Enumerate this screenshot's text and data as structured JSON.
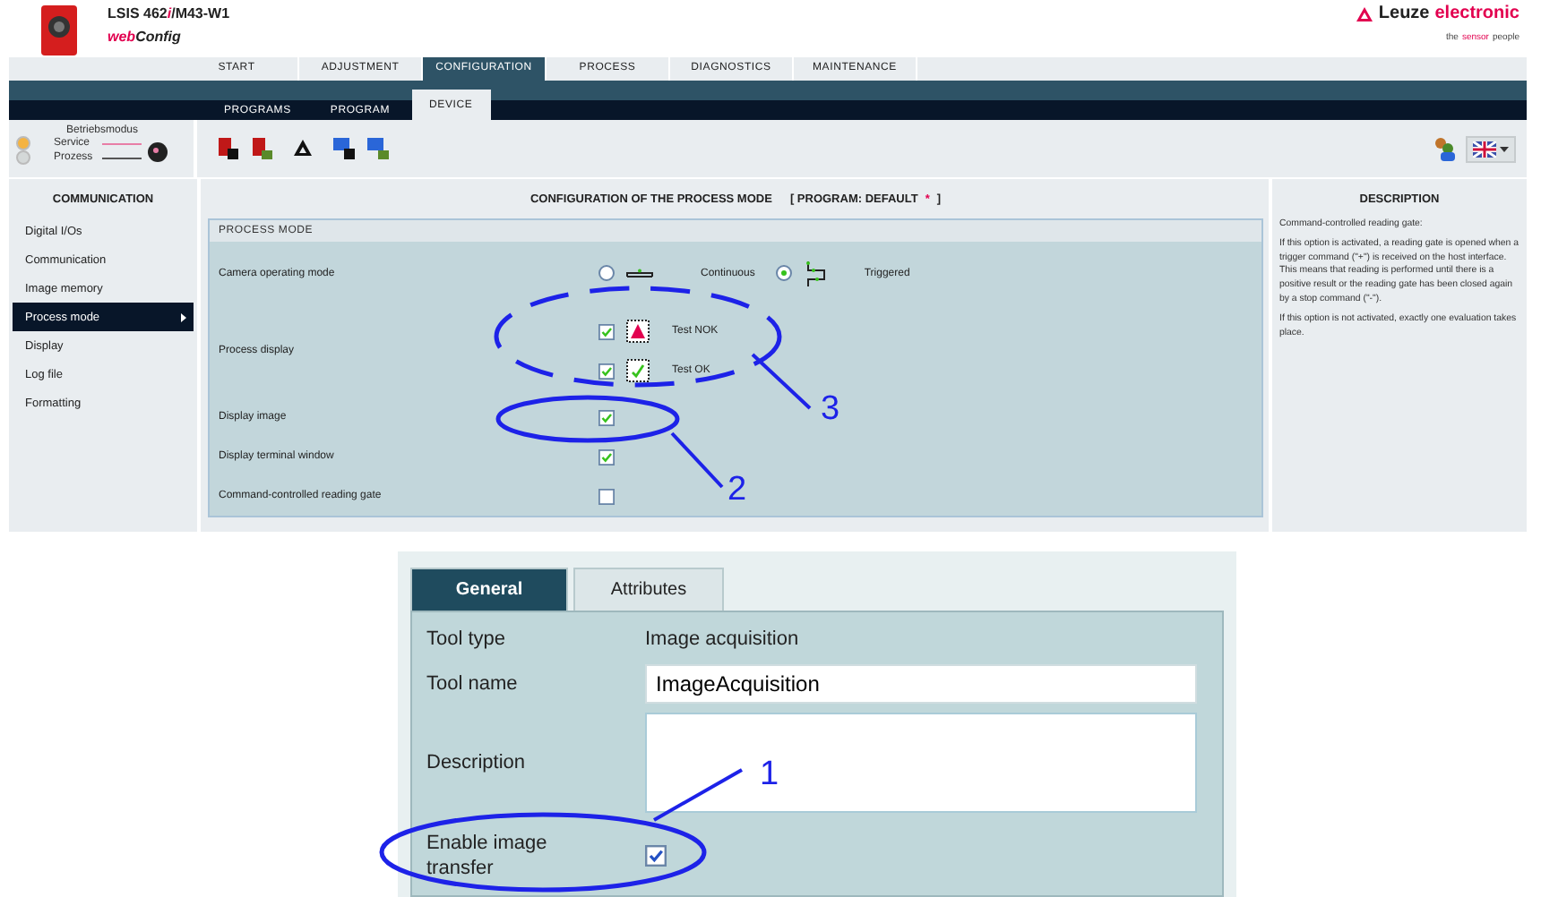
{
  "header": {
    "product": [
      {
        "text": "LSIS 462",
        "accent": false
      },
      {
        "text": "i",
        "accent": true
      },
      {
        "text": "/M43-W1",
        "accent": false
      }
    ],
    "app": "**web**Config",
    "brand": [
      {
        "text": "Leuze",
        "accent": false
      },
      {
        "text": "electronic",
        "accent": true
      }
    ],
    "tagline": [
      {
        "text": "the",
        "accent": false
      },
      {
        "text": "sensor",
        "accent": true
      },
      {
        "text": "people",
        "accent": false
      }
    ]
  },
  "main_tabs": [
    {
      "label": "START",
      "selected": false
    },
    {
      "label": "ADJUSTMENT",
      "selected": false
    },
    {
      "label": "CONFIGURATION",
      "selected": true
    },
    {
      "label": "PROCESS",
      "selected": false
    },
    {
      "label": "DIAGNOSTICS",
      "selected": false
    },
    {
      "label": "MAINTENANCE",
      "selected": false
    }
  ],
  "sub_tabs": [
    {
      "label": "PROGRAMS",
      "selected": false
    },
    {
      "label": "PROGRAM",
      "selected": false
    },
    {
      "label": "DEVICE",
      "selected": true
    }
  ],
  "operating_mode": {
    "title": "Betriebsmodus",
    "modes": [
      {
        "label": "Service",
        "selected": true
      },
      {
        "label": "Prozess",
        "selected": false
      }
    ]
  },
  "sidebar": {
    "heading": "COMMUNICATION",
    "items": [
      {
        "label": "Digital I/Os",
        "selected": false
      },
      {
        "label": "Communication",
        "selected": false
      },
      {
        "label": "Image memory",
        "selected": false
      },
      {
        "label": "Process mode",
        "selected": true
      },
      {
        "label": "Display",
        "selected": false
      },
      {
        "label": "Log file",
        "selected": false
      },
      {
        "label": "Formatting",
        "selected": false
      }
    ]
  },
  "content": {
    "title": "CONFIGURATION OF THE PROCESS MODE",
    "program": "[ PROGRAM: DEFAULT",
    "modified_mark": "*",
    "program_end": "]",
    "section": "PROCESS MODE",
    "rows": [
      {
        "kind": "radio",
        "label": "Camera operating mode",
        "options": [
          {
            "label": "Continuous",
            "kind": "continuous",
            "selected": false
          },
          {
            "label": "Triggered",
            "kind": "triggered",
            "selected": true
          }
        ]
      },
      {
        "kind": "checklist",
        "label": "Process display",
        "options": [
          {
            "label": "Test NOK",
            "kind": "nok",
            "checked": true
          },
          {
            "label": "Test OK",
            "kind": "ok",
            "checked": true
          }
        ]
      },
      {
        "kind": "checkbox",
        "label": "Display image",
        "checked": true
      },
      {
        "kind": "checkbox",
        "label": "Display terminal window",
        "checked": true
      },
      {
        "kind": "checkbox",
        "label": "Command-controlled reading gate",
        "checked": false
      }
    ]
  },
  "description": {
    "heading": "DESCRIPTION",
    "paragraphs": [
      "Command-controlled reading gate:",
      "If this option is activated, a reading gate is opened when a trigger command (\"+\") is received on the host interface. This means that reading is performed until there is a positive result or the reading gate has been closed again by a stop command (\"-\").",
      "If this option is not activated, exactly one evaluation takes place."
    ]
  },
  "tool_dialog": {
    "tabs": [
      {
        "label": "General",
        "selected": true
      },
      {
        "label": "Attributes",
        "selected": false
      }
    ],
    "rows": [
      {
        "kind": "text",
        "label": "Tool type",
        "value": "Image acquisition"
      },
      {
        "kind": "input",
        "label": "Tool name",
        "value": "ImageAcquisition"
      },
      {
        "kind": "textarea",
        "label": "Description"
      },
      {
        "kind": "checkbox",
        "label": "Enable image transfer",
        "checked": true
      }
    ]
  },
  "callouts": [
    "1",
    "2",
    "3"
  ]
}
